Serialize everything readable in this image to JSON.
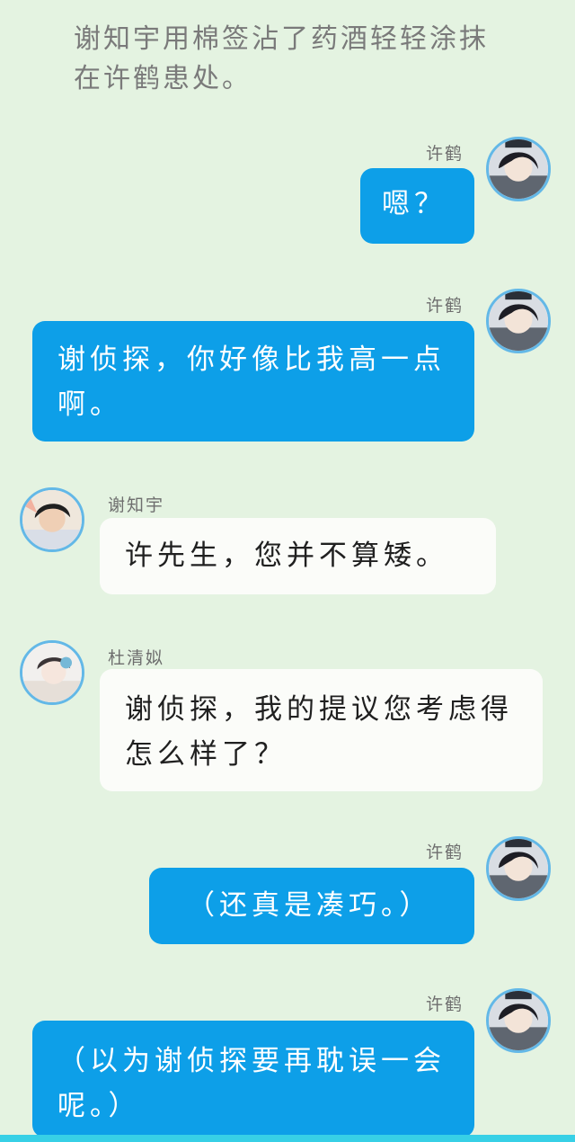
{
  "narration": "谢知宇用棉签沾了药酒轻轻涂抹在许鹤患处。",
  "messages": [
    {
      "speaker": "许鹤",
      "side": "right",
      "style": "blue",
      "text": "嗯？"
    },
    {
      "speaker": "许鹤",
      "side": "right",
      "style": "blue",
      "text": "谢侦探，你好像比我高一点啊。"
    },
    {
      "speaker": "谢知宇",
      "side": "left",
      "style": "white",
      "text": "许先生，您并不算矮。"
    },
    {
      "speaker": "杜清姒",
      "side": "left",
      "style": "white",
      "text": "谢侦探，我的提议您考虑得怎么样了？"
    },
    {
      "speaker": "许鹤",
      "side": "right",
      "style": "blue",
      "text": "（还真是凑巧。）"
    },
    {
      "speaker": "许鹤",
      "side": "right",
      "style": "blue",
      "text": "（以为谢侦探要再耽误一会呢。）"
    }
  ],
  "colors": {
    "background": "#e4f3e1",
    "blue_bubble": "#0d9fe8",
    "white_bubble": "#fbfcf9",
    "avatar_border": "#63b8e7",
    "bottom_bar": "#37d0e6"
  }
}
